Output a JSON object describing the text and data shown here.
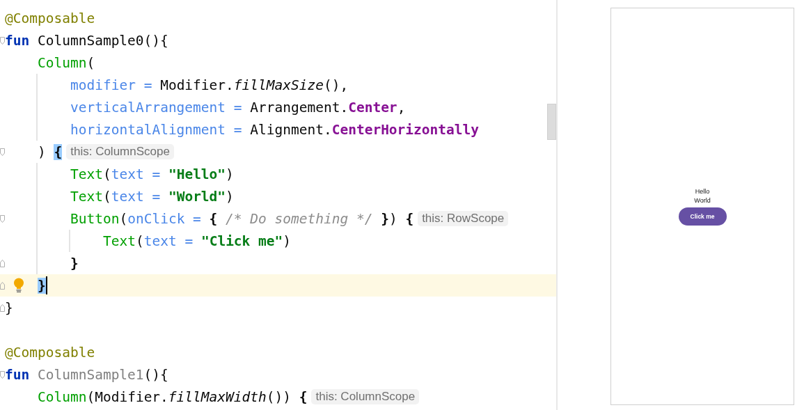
{
  "editor": {
    "blocks": [
      [
        {
          "fold_open": false,
          "fold_close": false,
          "current": false,
          "bulb": false,
          "tokens": [
            {
              "kind": "annotation",
              "text": "@Composable"
            }
          ]
        },
        {
          "fold_open": true,
          "fold_close": false,
          "current": false,
          "bulb": false,
          "tokens": [
            {
              "kind": "keyword",
              "text": "fun"
            },
            {
              "kind": "plain",
              "text": " ColumnSample0(){"
            }
          ],
          "children": [
            {
              "fold_open": false,
              "fold_close": false,
              "current": false,
              "bulb": false,
              "tokens": [
                {
                  "kind": "call",
                  "text": "Column"
                },
                {
                  "kind": "plain",
                  "text": "("
                }
              ],
              "children": [
                {
                  "fold_open": false,
                  "fold_close": false,
                  "current": false,
                  "bulb": false,
                  "tokens": [
                    {
                      "kind": "param",
                      "text": "modifier ="
                    },
                    {
                      "kind": "plain",
                      "text": " Modifier."
                    },
                    {
                      "kind": "extension",
                      "text": "fillMaxSize"
                    },
                    {
                      "kind": "plain",
                      "text": "(),"
                    }
                  ]
                },
                {
                  "fold_open": false,
                  "fold_close": false,
                  "current": false,
                  "bulb": false,
                  "tokens": [
                    {
                      "kind": "param",
                      "text": "verticalArrangement ="
                    },
                    {
                      "kind": "plain",
                      "text": " Arrangement."
                    },
                    {
                      "kind": "property",
                      "text": "Center"
                    },
                    {
                      "kind": "plain",
                      "text": ","
                    }
                  ]
                },
                {
                  "fold_open": false,
                  "fold_close": false,
                  "current": false,
                  "bulb": false,
                  "tokens": [
                    {
                      "kind": "param",
                      "text": "horizontalAlignment ="
                    },
                    {
                      "kind": "plain",
                      "text": " Alignment."
                    },
                    {
                      "kind": "property",
                      "text": "CenterHorizontally"
                    }
                  ]
                }
              ]
            },
            {
              "fold_open": true,
              "fold_close": false,
              "current": false,
              "bulb": false,
              "hint": "this: ColumnScope",
              "tokens": [
                {
                  "kind": "plain",
                  "text": ") "
                },
                {
                  "kind": "match",
                  "text": "{"
                }
              ],
              "children": [
                {
                  "fold_open": false,
                  "fold_close": false,
                  "current": false,
                  "bulb": false,
                  "tokens": [
                    {
                      "kind": "call",
                      "text": "Text"
                    },
                    {
                      "kind": "plain",
                      "text": "("
                    },
                    {
                      "kind": "param",
                      "text": "text ="
                    },
                    {
                      "kind": "string",
                      "text": " \"Hello\""
                    },
                    {
                      "kind": "plain",
                      "text": ")"
                    }
                  ]
                },
                {
                  "fold_open": false,
                  "fold_close": false,
                  "current": false,
                  "bulb": false,
                  "tokens": [
                    {
                      "kind": "call",
                      "text": "Text"
                    },
                    {
                      "kind": "plain",
                      "text": "("
                    },
                    {
                      "kind": "param",
                      "text": "text ="
                    },
                    {
                      "kind": "string",
                      "text": " \"World\""
                    },
                    {
                      "kind": "plain",
                      "text": ")"
                    }
                  ]
                },
                {
                  "fold_open": true,
                  "fold_close": false,
                  "current": false,
                  "bulb": false,
                  "hint": "this: RowScope",
                  "tokens": [
                    {
                      "kind": "call",
                      "text": "Button"
                    },
                    {
                      "kind": "plain",
                      "text": "("
                    },
                    {
                      "kind": "param",
                      "text": "onClick ="
                    },
                    {
                      "kind": "brace",
                      "text": " {"
                    },
                    {
                      "kind": "comment",
                      "text": " /* Do something */"
                    },
                    {
                      "kind": "brace",
                      "text": " }"
                    },
                    {
                      "kind": "plain",
                      "text": ")"
                    },
                    {
                      "kind": "brace",
                      "text": " {"
                    }
                  ],
                  "children": [
                    {
                      "fold_open": false,
                      "fold_close": false,
                      "current": false,
                      "bulb": false,
                      "tokens": [
                        {
                          "kind": "call",
                          "text": "Text"
                        },
                        {
                          "kind": "plain",
                          "text": "("
                        },
                        {
                          "kind": "param",
                          "text": "text ="
                        },
                        {
                          "kind": "string",
                          "text": " \"Click me\""
                        },
                        {
                          "kind": "plain",
                          "text": ")"
                        }
                      ]
                    }
                  ]
                },
                {
                  "fold_open": false,
                  "fold_close": true,
                  "current": false,
                  "bulb": false,
                  "tokens": [
                    {
                      "kind": "brace",
                      "text": "}"
                    }
                  ]
                }
              ]
            },
            {
              "fold_open": false,
              "fold_close": true,
              "current": true,
              "bulb": true,
              "tokens": [
                {
                  "kind": "match",
                  "text": "}"
                }
              ]
            }
          ]
        },
        {
          "fold_open": false,
          "fold_close": true,
          "current": false,
          "bulb": false,
          "tokens": [
            {
              "kind": "plain",
              "text": "}"
            }
          ]
        }
      ],
      [
        {
          "fold_open": false,
          "fold_close": false,
          "current": false,
          "bulb": false,
          "tokens": [
            {
              "kind": "annotation",
              "text": "@Composable"
            }
          ]
        },
        {
          "fold_open": true,
          "fold_close": false,
          "current": false,
          "bulb": false,
          "tokens": [
            {
              "kind": "keyword",
              "text": "fun"
            },
            {
              "kind": "unused",
              "text": " ColumnSample1"
            },
            {
              "kind": "plain",
              "text": "(){"
            }
          ],
          "children": [
            {
              "fold_open": false,
              "fold_close": false,
              "current": false,
              "bulb": false,
              "hint": "this: ColumnScope",
              "tokens": [
                {
                  "kind": "call",
                  "text": "Column"
                },
                {
                  "kind": "plain",
                  "text": "(Modifier."
                },
                {
                  "kind": "extension",
                  "text": "fillMaxWidth"
                },
                {
                  "kind": "plain",
                  "text": "())"
                },
                {
                  "kind": "brace",
                  "text": " {"
                }
              ]
            }
          ]
        }
      ]
    ]
  },
  "preview": {
    "texts": [
      "Hello",
      "World"
    ],
    "button": "Click me"
  }
}
